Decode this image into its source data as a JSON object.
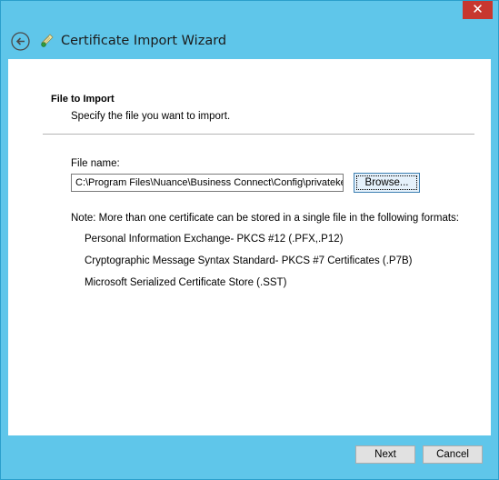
{
  "window": {
    "close_label": "✕",
    "title": "Certificate Import Wizard"
  },
  "page": {
    "section_title": "File to Import",
    "section_desc": "Specify the file you want to import.",
    "file_label": "File name:",
    "file_value": "C:\\Program Files\\Nuance\\Business Connect\\Config\\privateke",
    "browse_label": "Browse...",
    "note": "Note:  More than one certificate can be stored in a single file in the following formats:",
    "formats": [
      "Personal Information Exchange- PKCS #12 (.PFX,.P12)",
      "Cryptographic Message Syntax Standard- PKCS #7 Certificates (.P7B)",
      "Microsoft Serialized Certificate Store (.SST)"
    ]
  },
  "footer": {
    "next_label": "Next",
    "cancel_label": "Cancel"
  },
  "colors": {
    "frame": "#5fc6ea",
    "close": "#c7372f",
    "content_bg": "#ffffff"
  }
}
